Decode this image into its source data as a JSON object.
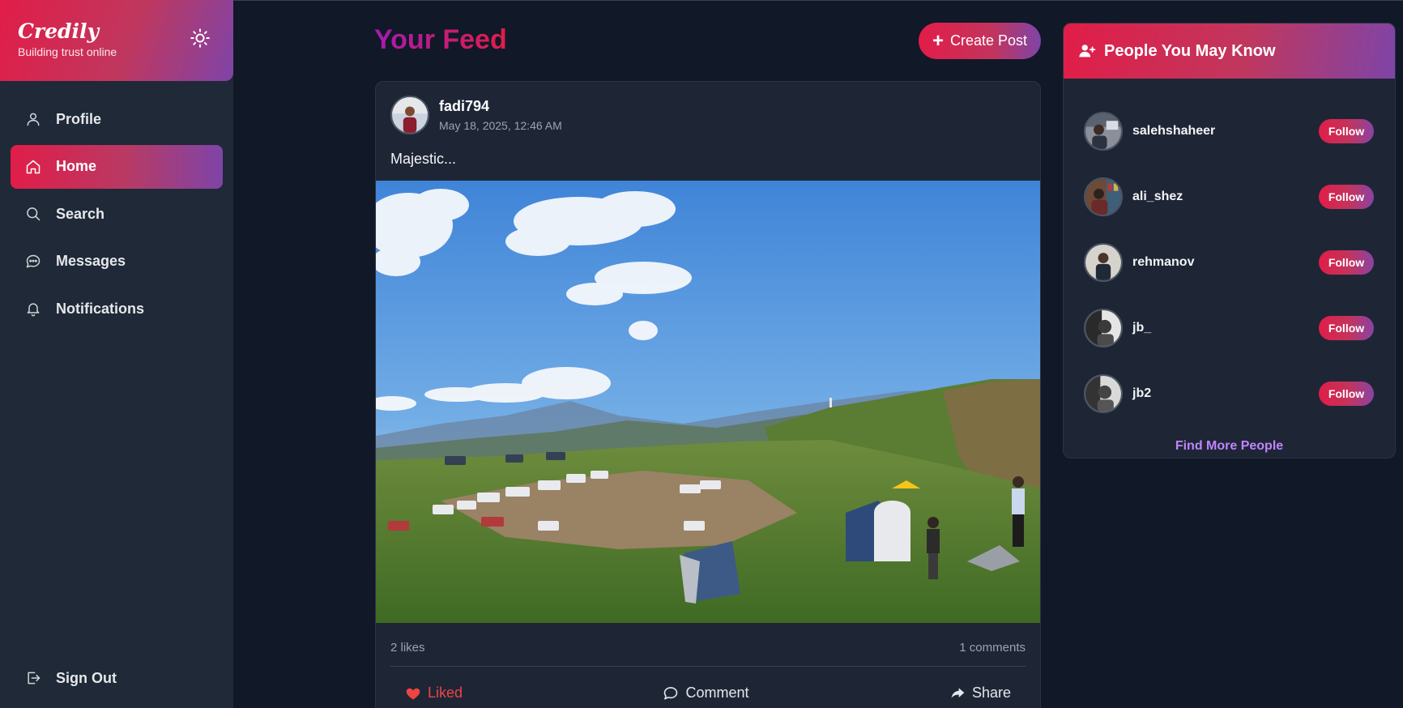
{
  "brand": {
    "name": "Credily",
    "tagline": "Building trust online"
  },
  "nav": {
    "items": [
      {
        "label": "Profile",
        "icon": "user-icon"
      },
      {
        "label": "Home",
        "icon": "home-icon",
        "active": true
      },
      {
        "label": "Search",
        "icon": "search-icon"
      },
      {
        "label": "Messages",
        "icon": "message-icon"
      },
      {
        "label": "Notifications",
        "icon": "bell-icon"
      }
    ],
    "sign_out": "Sign Out"
  },
  "feed": {
    "title": "Your Feed",
    "create_post": "Create Post"
  },
  "post": {
    "username": "fadi794",
    "time": "May 18, 2025, 12:46 AM",
    "text": "Majestic...",
    "likes": "2 likes",
    "comments": "1 comments",
    "actions": {
      "like": "Liked",
      "comment": "Comment",
      "share": "Share"
    }
  },
  "people": {
    "title": "People You May Know",
    "follow_label": "Follow",
    "users": [
      "salehshaheer",
      "ali_shez",
      "rehmanov",
      "jb_",
      "jb2"
    ],
    "find_more": "Find More People"
  },
  "colors": {
    "accent_red": "#e11d48",
    "accent_purple": "#7e44a8",
    "background": "#111827",
    "sidebar": "#1f2937",
    "link": "#c084fc",
    "liked": "#ef4444"
  }
}
